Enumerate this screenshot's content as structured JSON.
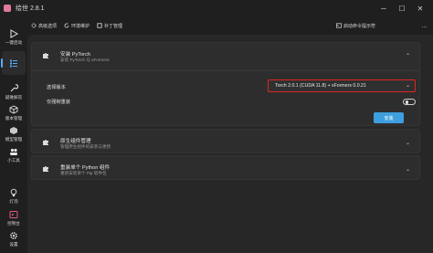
{
  "window": {
    "title": "绘世 2.8.1",
    "controls": [
      "─",
      "☐",
      "✕"
    ]
  },
  "sidebar": {
    "items": [
      {
        "label": "一键启动",
        "icon": "play-icon"
      },
      {
        "label": "",
        "icon": "list-icon",
        "active": true
      },
      {
        "label": "疑难解答",
        "icon": "wrench-icon"
      },
      {
        "label": "版本管理",
        "icon": "cube-icon"
      },
      {
        "label": "模型管理",
        "icon": "box-icon"
      },
      {
        "label": "小工具",
        "icon": "people-icon"
      },
      {
        "label": "灯泡",
        "icon": "bulb-icon"
      },
      {
        "label": "控制台",
        "icon": "console-icon"
      },
      {
        "label": "设置",
        "icon": "gear-icon"
      }
    ]
  },
  "toolbar": {
    "items": [
      {
        "label": "高级选项",
        "icon": "settings-icon"
      },
      {
        "label": "环境维护",
        "icon": "refresh-icon"
      },
      {
        "label": "补丁管理",
        "icon": "patch-icon"
      }
    ],
    "launch_label": "启动命令提示符",
    "more": "…",
    "accent_color": "#5aa9ff"
  },
  "cards": {
    "pytorch": {
      "title": "安装 PyTorch",
      "subtitle": "安装 PyTorch 与 xFormers",
      "version_label": "选择版本",
      "version_value": "Torch 2.0.1 (CUDA 11.8) + xFormers 0.0.21",
      "reinstall_label": "仅强制重装",
      "reinstall_on": false,
      "install_label": "安装",
      "highlight_color": "#e02424",
      "button_color": "#3e9fe0"
    },
    "native": {
      "title": "原生组件管理",
      "subtitle": "管理原生组件的安装与更新"
    },
    "python": {
      "title": "重装单个 Python 组件",
      "subtitle": "重新安装单个 Pip 软件包"
    }
  }
}
